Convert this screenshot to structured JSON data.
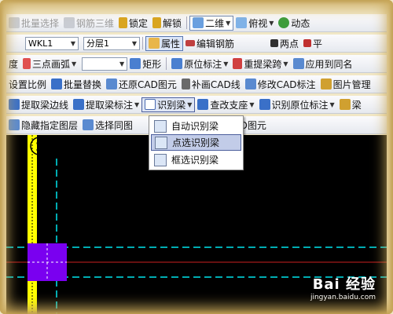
{
  "colors": {
    "accent": "#1a3f9e",
    "canvas": "#000000",
    "beam_yellow": "#ffff00",
    "axis_cyan": "#00e5ee",
    "column_purple": "#7a00f0",
    "menu_highlight": "#c2cce8"
  },
  "row1": {
    "batch_select": "批量选择",
    "rebar_3d": "钢筋三维",
    "lock": "锁定",
    "unlock": "解锁",
    "view_2d": "二维",
    "view_cut": "俯视",
    "dynamic": "动态"
  },
  "row2": {
    "element_combo": "WKL1",
    "floor_combo": "分层1",
    "properties": "属性",
    "edit_rebar": "编辑钢筋",
    "two_points": "两点",
    "parallel": "平"
  },
  "row3": {
    "degree": "度",
    "arc_combo": "三点画弧",
    "rectangle": "矩形",
    "in_situ_mark": "原位标注",
    "re_extract_span": "重提梁跨",
    "apply_same_name": "应用到同名"
  },
  "row4": {
    "set_scale": "设置比例",
    "batch_replace": "批量替换",
    "restore_cad": "还原CAD图元",
    "patch_cad_line": "补画CAD线",
    "modify_cad_mark": "修改CAD标注",
    "image_manage": "图片管理"
  },
  "row5": {
    "extract_beam_edge": "提取梁边线",
    "extract_beam_mark": "提取梁标注",
    "identify_beam": "识别梁",
    "check_support": "查改支座",
    "identify_in_situ": "识别原位标注",
    "beam_partial": "梁"
  },
  "row6": {
    "hide_layer": "隐藏指定图层",
    "select_same": "选择同图",
    "color_cad": "颜色CAD图元"
  },
  "menu": {
    "items": [
      {
        "label": "自动识别梁",
        "highlighted": false
      },
      {
        "label": "点选识别梁",
        "highlighted": true
      },
      {
        "label": "框选识别梁",
        "highlighted": false
      }
    ]
  },
  "canvas": {
    "axis_label": "1"
  },
  "watermark": {
    "logo": "Bai 经验",
    "url": "jingyan.baidu.com"
  }
}
